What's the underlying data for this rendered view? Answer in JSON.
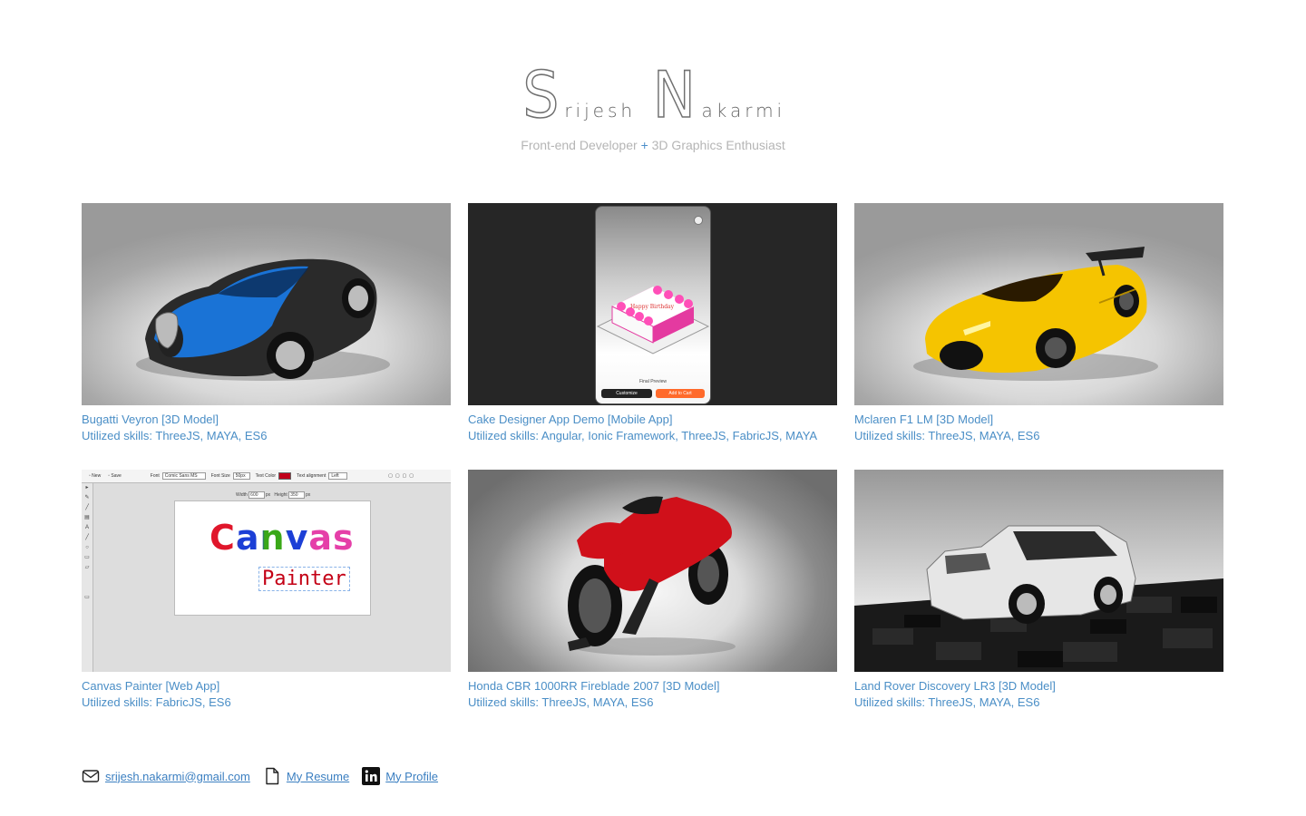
{
  "header": {
    "name_initial_1": "S",
    "name_rest_1": "rijesh",
    "name_initial_2": "N",
    "name_rest_2": "akarmi",
    "tagline_left": "Front-end Developer",
    "tagline_plus": "+",
    "tagline_right": "3D Graphics Enthusiast"
  },
  "projects": [
    {
      "title": "Bugatti Veyron [3D Model]",
      "skills": "Utilized skills: ThreeJS, MAYA, ES6"
    },
    {
      "title": "Cake Designer App Demo [Mobile App]",
      "skills": "Utilized skills: Angular, Ionic Framework, ThreeJS, FabricJS, MAYA"
    },
    {
      "title": "Mclaren F1 LM [3D Model]",
      "skills": "Utilized skills: ThreeJS, MAYA, ES6"
    },
    {
      "title": "Canvas Painter [Web App]",
      "skills": "Utilized skills: FabricJS, ES6"
    },
    {
      "title": "Honda CBR 1000RR Fireblade 2007 [3D Model]",
      "skills": "Utilized skills: ThreeJS, MAYA, ES6"
    },
    {
      "title": "Land Rover Discovery LR3 [3D Model]",
      "skills": "Utilized skills: ThreeJS, MAYA, ES6"
    }
  ],
  "thumb_text": {
    "cake_preview": "Final Preview",
    "cake_customize": "Customize",
    "cake_add": "Add to Cart",
    "cake_message": "Happy Birthday",
    "painter_new": "New",
    "painter_save": "Save",
    "painter_font": "Font",
    "painter_font_value": "Comic Sans MS",
    "painter_font_size": "Font Size",
    "painter_font_size_value": "50px",
    "painter_text_color": "Text Color",
    "painter_text_align": "Text alignment",
    "painter_text_align_value": "Left",
    "painter_width": "Width",
    "painter_width_value": "600",
    "painter_height": "Height",
    "painter_height_value": "350",
    "painter_unit": "px",
    "painter_word1": "Canvas",
    "painter_word2": "Painter"
  },
  "footer": {
    "email": "srijesh.nakarmi@gmail.com",
    "resume": "My Resume",
    "profile": "My Profile",
    "icons": [
      "mail-icon",
      "document-icon",
      "linkedin-icon"
    ]
  },
  "colors": {
    "accent": "#4a8ec6",
    "link": "#3b7fc1",
    "name": "#707070",
    "tagline": "#b5b5b5"
  }
}
